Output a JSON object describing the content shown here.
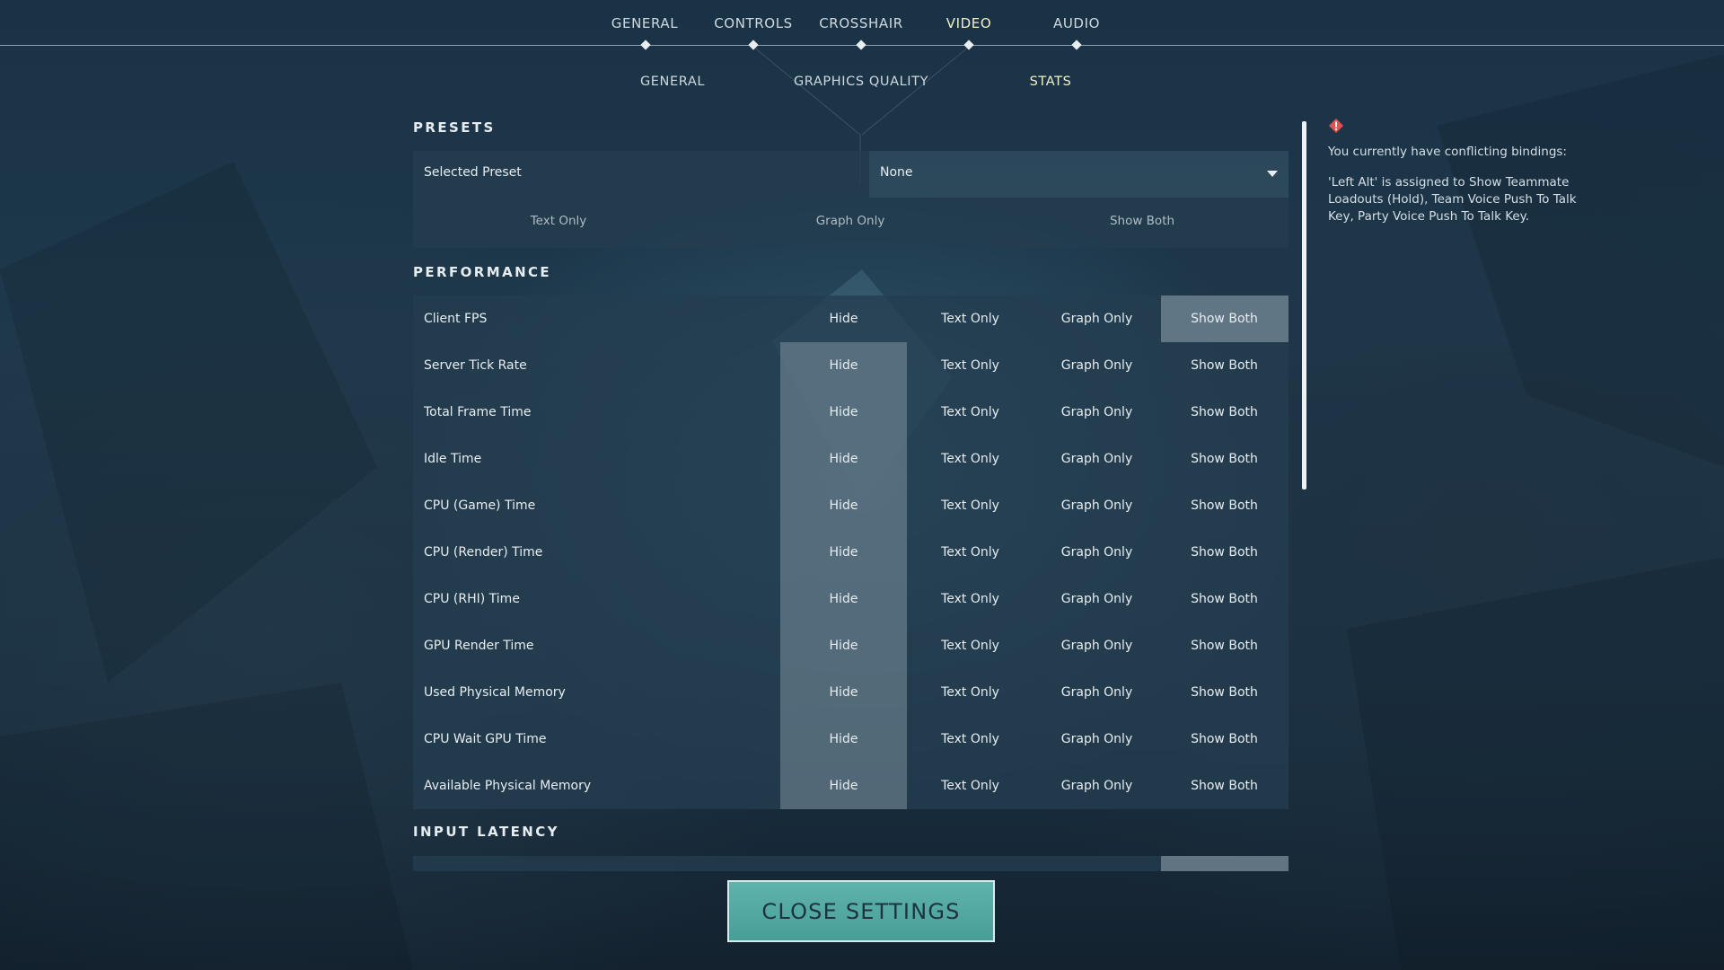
{
  "nav": {
    "tabs": [
      {
        "label": "GENERAL"
      },
      {
        "label": "CONTROLS"
      },
      {
        "label": "CROSSHAIR"
      },
      {
        "label": "VIDEO"
      },
      {
        "label": "AUDIO"
      }
    ],
    "active_tab": "VIDEO"
  },
  "subnav": {
    "tabs": [
      {
        "label": "GENERAL"
      },
      {
        "label": "GRAPHICS QUALITY"
      },
      {
        "label": "STATS"
      }
    ],
    "active_tab": "STATS"
  },
  "presets": {
    "title": "PRESETS",
    "selected_label": "Selected Preset",
    "selected_value": "None",
    "options": [
      "Text Only",
      "Graph Only",
      "Show Both"
    ]
  },
  "performance": {
    "title": "PERFORMANCE",
    "option_labels": [
      "Hide",
      "Text Only",
      "Graph Only",
      "Show Both"
    ],
    "rows": [
      {
        "label": "Client FPS",
        "selected": "Show Both"
      },
      {
        "label": "Server Tick Rate",
        "selected": "Hide"
      },
      {
        "label": "Total Frame Time",
        "selected": "Hide"
      },
      {
        "label": "Idle Time",
        "selected": "Hide"
      },
      {
        "label": "CPU (Game) Time",
        "selected": "Hide"
      },
      {
        "label": "CPU (Render) Time",
        "selected": "Hide"
      },
      {
        "label": "CPU (RHI) Time",
        "selected": "Hide"
      },
      {
        "label": "GPU Render Time",
        "selected": "Hide"
      },
      {
        "label": "Used Physical Memory",
        "selected": "Hide"
      },
      {
        "label": "CPU Wait GPU Time",
        "selected": "Hide"
      },
      {
        "label": "Available Physical Memory",
        "selected": "Hide"
      }
    ]
  },
  "input_latency": {
    "title": "INPUT LATENCY"
  },
  "conflict": {
    "icon": "warning-diamond-icon",
    "title": "You currently have conflicting bindings:",
    "body": "'Left Alt' is assigned to Show Teammate Loadouts (Hold), Team Voice Push To Talk Key, Party Voice Push To Talk Key."
  },
  "close_button": {
    "label": "CLOSE SETTINGS"
  },
  "colors": {
    "accent_teal": "#5fb3ac",
    "active_tab": "#f2f0c8",
    "warning": "#e0524f"
  }
}
